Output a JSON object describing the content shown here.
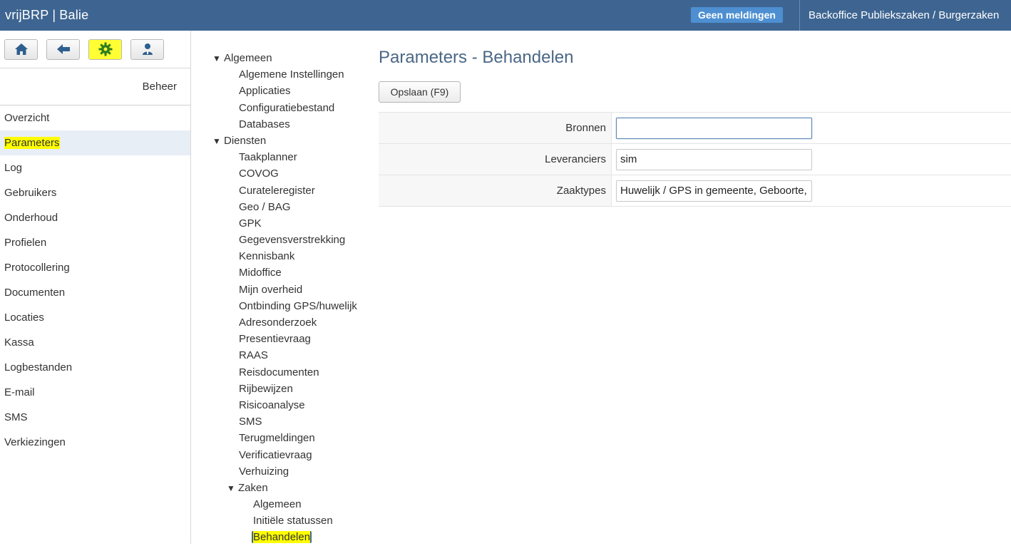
{
  "app": {
    "name": "vrijBRP",
    "separator": "|",
    "module": "Balie"
  },
  "header": {
    "notifications_label": "Geen meldingen",
    "user_context": "Backoffice Publiekszaken / Burgerzaken"
  },
  "toolbar": {
    "buttons": [
      "home-icon",
      "back-arrow-icon",
      "gear-icon",
      "user-icon"
    ]
  },
  "sidebar": {
    "section_title": "Beheer",
    "items": [
      {
        "label": "Overzicht"
      },
      {
        "label": "Parameters",
        "active": true
      },
      {
        "label": "Log"
      },
      {
        "label": "Gebruikers"
      },
      {
        "label": "Onderhoud"
      },
      {
        "label": "Profielen"
      },
      {
        "label": "Protocollering"
      },
      {
        "label": "Documenten"
      },
      {
        "label": "Locaties"
      },
      {
        "label": "Kassa"
      },
      {
        "label": "Logbestanden"
      },
      {
        "label": "E-mail"
      },
      {
        "label": "SMS"
      },
      {
        "label": "Verkiezingen"
      }
    ]
  },
  "tree": {
    "groups": [
      {
        "label": "Algemeen",
        "children": [
          "Algemene Instellingen",
          "Applicaties",
          "Configuratiebestand",
          "Databases"
        ]
      },
      {
        "label": "Diensten",
        "children": [
          "Taakplanner",
          "COVOG",
          "Curateleregister",
          "Geo / BAG",
          "GPK",
          "Gegevensverstrekking",
          "Kennisbank",
          "Midoffice",
          "Mijn overheid",
          "Ontbinding GPS/huwelijk",
          "Adresonderzoek",
          "Presentievraag",
          "RAAS",
          "Reisdocumenten",
          "Rijbewijzen",
          "Risicoanalyse",
          "SMS",
          "Terugmeldingen",
          "Verificatievraag",
          "Verhuizing"
        ],
        "subgroup": {
          "label": "Zaken",
          "children": [
            "Algemeen",
            "Initiële statussen",
            "Behandelen"
          ]
        }
      }
    ],
    "selected": "Behandelen"
  },
  "main": {
    "title": "Parameters - Behandelen",
    "save_label": "Opslaan (F9)",
    "fields": [
      {
        "label": "Bronnen",
        "value": ""
      },
      {
        "label": "Leveranciers",
        "value": "sim"
      },
      {
        "label": "Zaaktypes",
        "value": "Huwelijk / GPS in gemeente, Geboorte,"
      }
    ]
  },
  "colors": {
    "header_bg": "#3e6591",
    "notif_bg": "#4d8fd1",
    "highlight": "#ffff00",
    "active_menu_bg": "#e8eef6"
  }
}
